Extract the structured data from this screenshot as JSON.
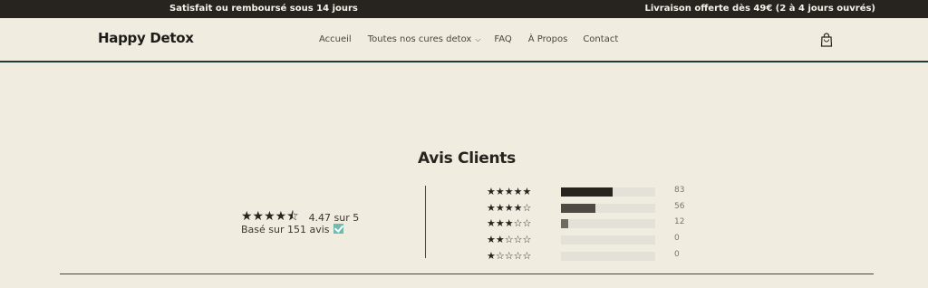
{
  "announcement": {
    "left": "Satisfait ou remboursé sous 14 jours",
    "right": "Livraison offerte dès 49€ (2 à 4 jours ouvrés)"
  },
  "header": {
    "logo": "Happy Detox",
    "nav": [
      "Accueil",
      "Toutes nos cures detox",
      "FAQ",
      "À Propos",
      "Contact"
    ]
  },
  "reviews": {
    "title": "Avis Clients",
    "average_stars": "★★★★⯪",
    "average_text": "4.47 sur 5",
    "based_on": "Basé sur 151 avis",
    "distribution": [
      {
        "stars": "★★★★★",
        "count": "83",
        "fraction": 0.55,
        "color": "#27241f"
      },
      {
        "stars": "★★★★☆",
        "count": "56",
        "fraction": 0.37,
        "color": "#4e4a43"
      },
      {
        "stars": "★★★☆☆",
        "count": "12",
        "fraction": 0.08,
        "color": "#6f6b63"
      },
      {
        "stars": "★★☆☆☆",
        "count": "0",
        "fraction": 0,
        "color": "#6f6b63"
      },
      {
        "stars": "★☆☆☆☆",
        "count": "0",
        "fraction": 0,
        "color": "#6f6b63"
      }
    ]
  }
}
